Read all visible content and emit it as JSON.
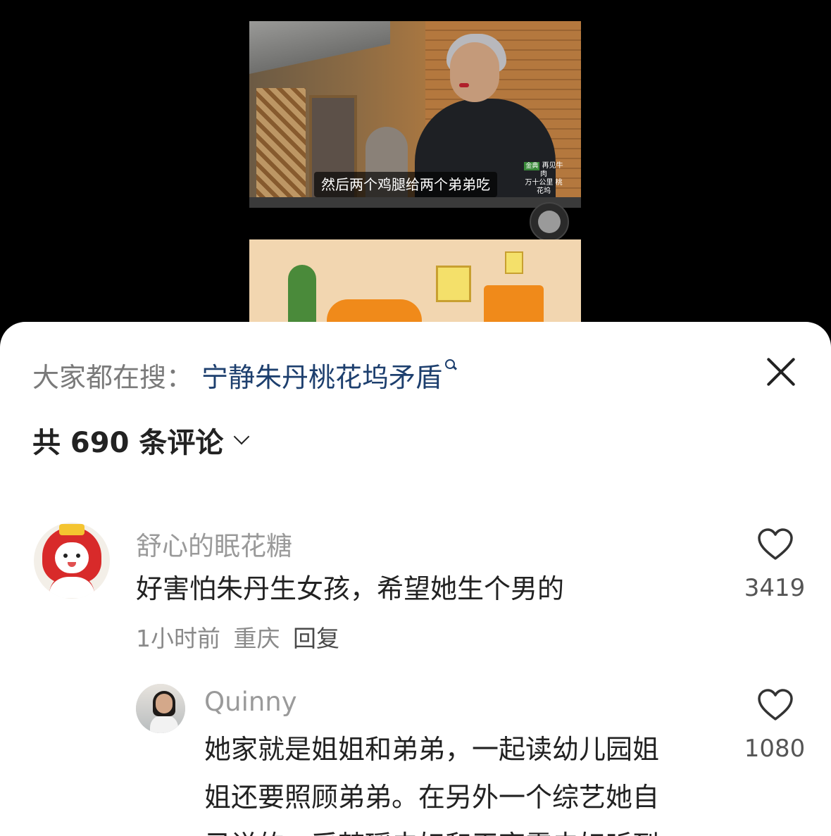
{
  "video": {
    "subtitle": "然后两个鸡腿给两个弟弟吃",
    "logo_mark": "金典",
    "logo_title": "再见牛肉",
    "logo_sub": "万十公里 桃花坞"
  },
  "sheet": {
    "search_prefix": "大家都在搜：",
    "search_query": "宁静朱丹桃花坞矛盾",
    "comment_count_label": "共 690 条评论"
  },
  "comments": [
    {
      "username": "舒心的眠花糖",
      "text": "好害怕朱丹生女孩，希望她生个男的",
      "time": "1小时前",
      "location": "重庆",
      "reply_label": "回复",
      "likes": "3419"
    },
    {
      "username": "Quinny",
      "text_lines": [
        "她家就是姐姐和弟弟，一起读幼儿园姐",
        "姐还要照顾弟弟。在另外一个综艺她自",
        "己说的，采梦瑶夫妇和王亮霞夫妇听到"
      ],
      "likes": "1080"
    }
  ],
  "icons": {
    "close": "close-icon",
    "search": "search-icon",
    "chevron": "chevron-down-icon",
    "like": "heart-outline-icon"
  },
  "colors": {
    "search_query": "#1d3f6e",
    "username": "#9a9a9a",
    "text": "#222222"
  }
}
